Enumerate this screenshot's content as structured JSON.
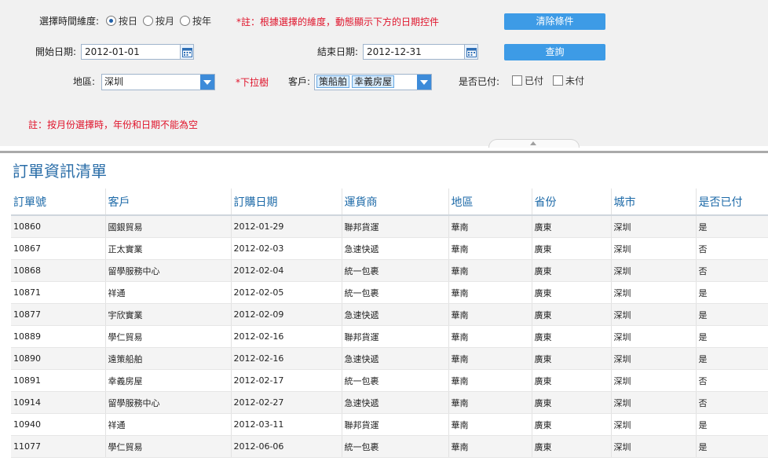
{
  "filters": {
    "dimension_label": "選擇時間維度:",
    "dimension_options": [
      {
        "label": "按日",
        "checked": true
      },
      {
        "label": "按月",
        "checked": false
      },
      {
        "label": "按年",
        "checked": false
      }
    ],
    "dimension_note": "*註：根據選擇的維度，動態顯示下方的日期控件",
    "clear_button": "清除條件",
    "start_date_label": "開始日期:",
    "start_date_value": "2012-01-01",
    "end_date_label": "結束日期:",
    "end_date_value": "2012-12-31",
    "query_button": "查詢",
    "region_label": "地區:",
    "region_value": "深圳",
    "dropdown_note": "*下拉樹",
    "customer_label": "客戶:",
    "customer_tags": [
      "策船舶",
      "幸義房屋"
    ],
    "paid_label": "是否已付:",
    "paid_options": [
      {
        "label": "已付",
        "checked": false
      },
      {
        "label": "未付",
        "checked": false
      }
    ],
    "month_note": "註：按月份選擇時，年份和日期不能為空"
  },
  "table": {
    "title": "訂單資訊清單",
    "columns": [
      "訂單號",
      "客戶",
      "訂購日期",
      "運貨商",
      "地區",
      "省份",
      "城市",
      "是否已付"
    ],
    "rows": [
      [
        "10860",
        "國銀貿易",
        "2012-01-29",
        "聯邦貨運",
        "華南",
        "廣東",
        "深圳",
        "是"
      ],
      [
        "10867",
        "正太實業",
        "2012-02-03",
        "急速快遞",
        "華南",
        "廣東",
        "深圳",
        "否"
      ],
      [
        "10868",
        "留學服務中心",
        "2012-02-04",
        "統一包裹",
        "華南",
        "廣東",
        "深圳",
        "否"
      ],
      [
        "10871",
        "祥通",
        "2012-02-05",
        "統一包裹",
        "華南",
        "廣東",
        "深圳",
        "是"
      ],
      [
        "10877",
        "宇欣實業",
        "2012-02-09",
        "急速快遞",
        "華南",
        "廣東",
        "深圳",
        "是"
      ],
      [
        "10889",
        "學仁貿易",
        "2012-02-16",
        "聯邦貨運",
        "華南",
        "廣東",
        "深圳",
        "是"
      ],
      [
        "10890",
        "遠策船舶",
        "2012-02-16",
        "急速快遞",
        "華南",
        "廣東",
        "深圳",
        "是"
      ],
      [
        "10891",
        "幸義房屋",
        "2012-02-17",
        "統一包裹",
        "華南",
        "廣東",
        "深圳",
        "否"
      ],
      [
        "10914",
        "留學服務中心",
        "2012-02-27",
        "急速快遞",
        "華南",
        "廣東",
        "深圳",
        "否"
      ],
      [
        "10940",
        "祥通",
        "2012-03-11",
        "聯邦貨運",
        "華南",
        "廣東",
        "深圳",
        "是"
      ],
      [
        "11077",
        "學仁貿易",
        "2012-06-06",
        "統一包裹",
        "華南",
        "廣東",
        "深圳",
        "是"
      ]
    ]
  },
  "icons": {
    "calendar": "calendar-icon",
    "dropdown": "chevron-down-icon",
    "collapse": "chevron-up-icon"
  },
  "colors": {
    "button": "#3d9be6",
    "note_red": "#e0142b",
    "title_blue": "#2b6ea8"
  }
}
